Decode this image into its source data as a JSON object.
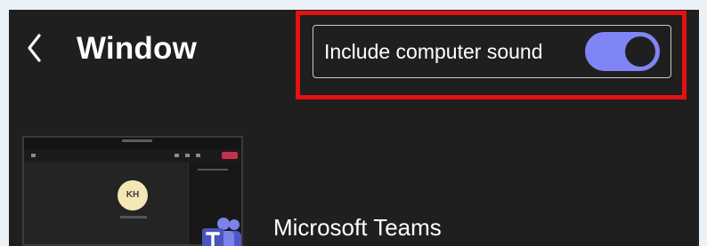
{
  "header": {
    "title": "Window",
    "back_icon": "chevron-left-icon"
  },
  "computer_sound": {
    "label": "Include computer sound",
    "enabled": true,
    "accent_color": "#7f85f5"
  },
  "window_list": {
    "items": [
      {
        "label": "Microsoft Teams",
        "icon": "microsoft-teams-icon",
        "thumbnail": {
          "avatar_initials": "KH"
        }
      }
    ]
  },
  "highlight": {
    "color": "#e31212"
  }
}
